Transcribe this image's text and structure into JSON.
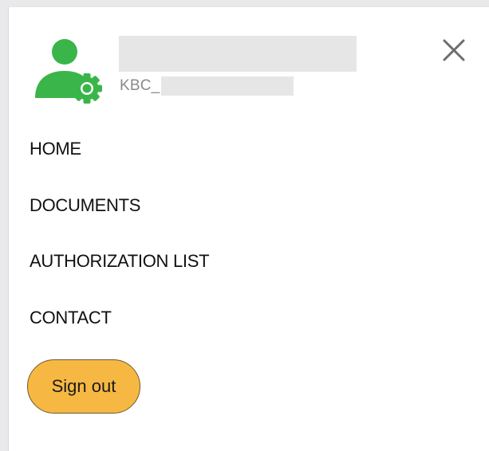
{
  "header": {
    "user_name": "",
    "user_id_prefix": "KBC_",
    "user_id_rest": "",
    "avatar_icon": "user-settings-icon",
    "close_icon": "close-icon"
  },
  "nav": {
    "items": [
      {
        "label": "HOME"
      },
      {
        "label": "DOCUMENTS"
      },
      {
        "label": "AUTHORIZATION LIST"
      },
      {
        "label": "CONTACT"
      }
    ]
  },
  "actions": {
    "sign_out_label": "Sign out"
  },
  "colors": {
    "avatar_green": "#3ab54a",
    "sign_out_bg": "#f7b843",
    "redaction_gray": "#e6e6e6"
  }
}
